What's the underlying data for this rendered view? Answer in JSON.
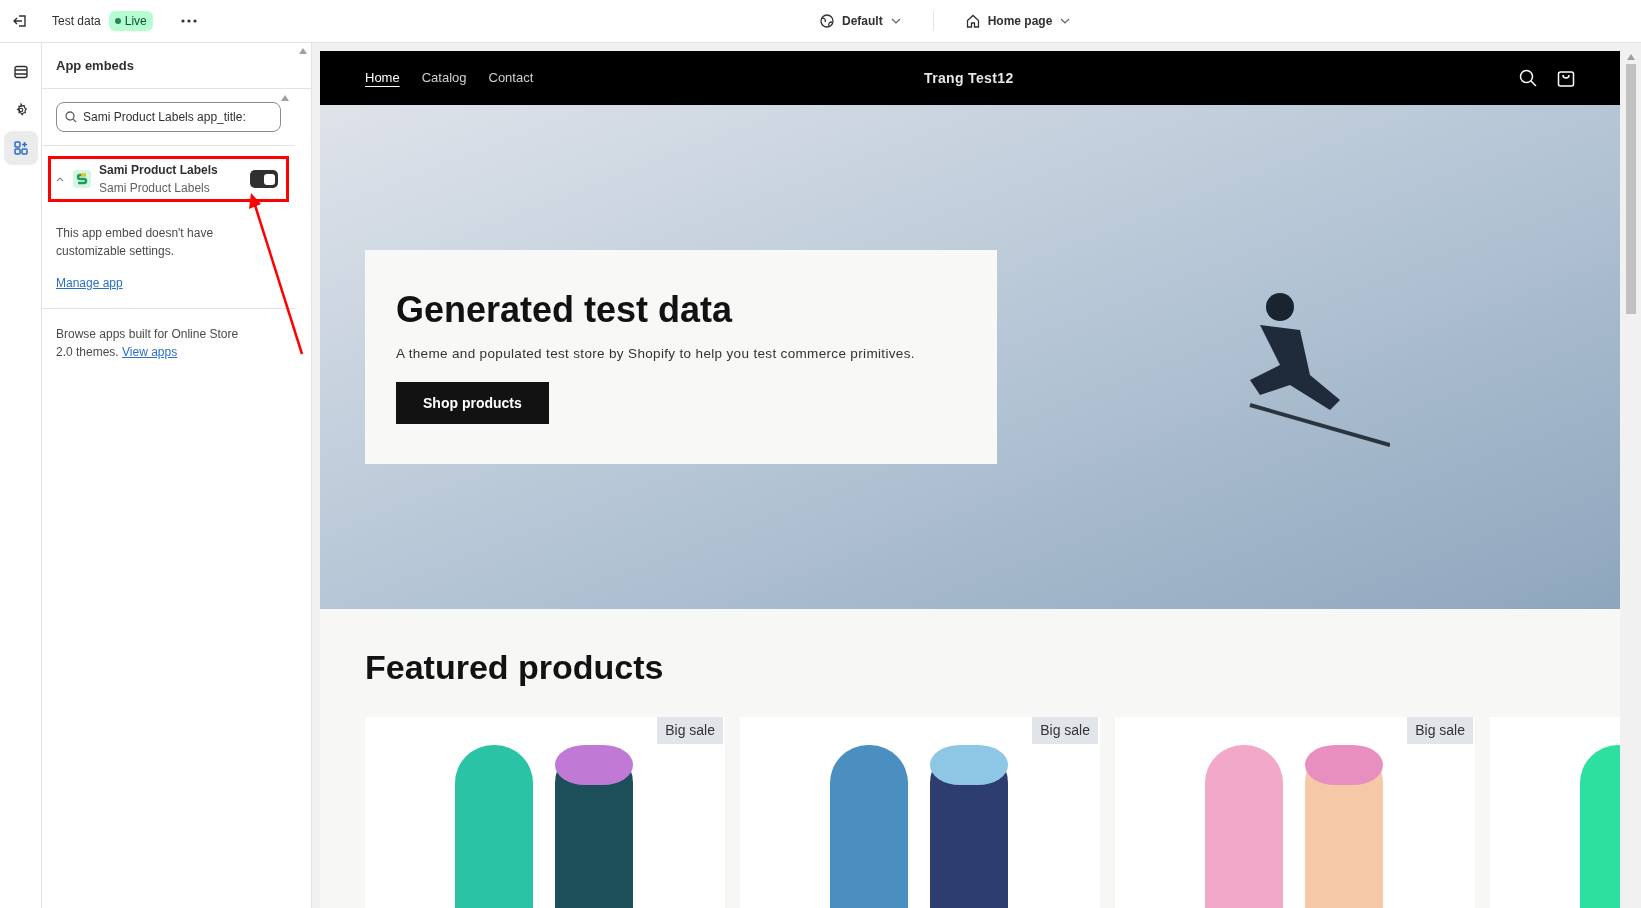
{
  "topbar": {
    "title": "Test data",
    "status": "Live",
    "theme": "Default",
    "page": "Home page"
  },
  "rail": [
    {
      "selected": false
    },
    {
      "selected": false
    },
    {
      "selected": true
    }
  ],
  "sidebar": {
    "heading": "App embeds",
    "search": {
      "value": "Sami Product Labels app_title:"
    },
    "embed": {
      "name": "Sami Product Labels",
      "subtitle": "Sami Product Labels",
      "expanded": true,
      "on": true,
      "highlighted": true,
      "note": "This app embed doesn't have customizable settings.",
      "link": "Manage app"
    },
    "browse": {
      "text": "Browse apps built for Online Store 2.0 themes.",
      "link": "View apps"
    }
  },
  "store": {
    "nav": [
      {
        "label": "Home",
        "selected": true
      },
      {
        "label": "Catalog",
        "selected": false
      },
      {
        "label": "Contact",
        "selected": false
      }
    ],
    "brand": "Trang Test12",
    "hero": {
      "heading": "Generated test data",
      "text": "A theme and populated test store by Shopify to help you test commerce primitives.",
      "button": "Shop products"
    },
    "featured": "Featured products",
    "products": [
      {
        "badge": "Big sale"
      },
      {
        "badge": "Big sale"
      },
      {
        "badge": "Big sale"
      }
    ]
  }
}
